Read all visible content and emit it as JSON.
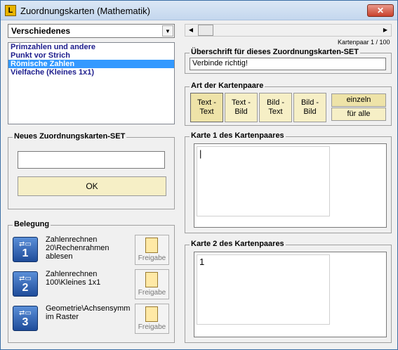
{
  "window": {
    "title": "Zuordnungskarten (Mathematik)",
    "app_icon_letter": "L",
    "close_symbol": "✕"
  },
  "category": {
    "selected": "Verschiedenes",
    "arrow": "▼"
  },
  "set_list": [
    {
      "label": "Primzahlen und andere",
      "selected": false
    },
    {
      "label": "Punkt vor Strich",
      "selected": false
    },
    {
      "label": "Römische Zahlen",
      "selected": true
    },
    {
      "label": "Vielfache (Kleines 1x1)",
      "selected": false
    }
  ],
  "new_set": {
    "label": "Neues Zuordnungskarten-SET",
    "value": "",
    "ok_label": "OK"
  },
  "belegung": {
    "label": "Belegung",
    "slots": [
      {
        "number": "1",
        "text": "Zahlenrechnen\n20\\Rechenrahmen\nablesen",
        "release_label": "Freigabe"
      },
      {
        "number": "2",
        "text": "Zahlenrechnen\n100\\Kleines 1x1",
        "release_label": "Freigabe"
      },
      {
        "number": "3",
        "text": "Geometrie\\Achsensymme\nim Raster",
        "release_label": "Freigabe"
      }
    ]
  },
  "pager": {
    "text": "Kartenpaar 1 / 100",
    "left_arrow": "◀",
    "right_arrow": "▶"
  },
  "heading_group": {
    "label": "Überschrift für dieses Zuordnungskarten-SET",
    "value": "Verbinde richtig!"
  },
  "type_group": {
    "label": "Art der Kartenpaare",
    "types": [
      {
        "line1": "Text -",
        "line2": "Text",
        "selected": true
      },
      {
        "line1": "Text -",
        "line2": "Bild",
        "selected": false
      },
      {
        "line1": "Bild -",
        "line2": "Text",
        "selected": false
      },
      {
        "line1": "Bild -",
        "line2": "Bild",
        "selected": false
      }
    ],
    "scope_single": "einzeln",
    "scope_all": "für alle"
  },
  "card1": {
    "label": "Karte 1 des Kartenpaares",
    "value": "|"
  },
  "card2": {
    "label": "Karte 2 des Kartenpaares",
    "value": "1"
  },
  "colors": {
    "accent": "#3399ff",
    "button_fill": "#f6efc6",
    "list_text": "#1c1c8c"
  }
}
